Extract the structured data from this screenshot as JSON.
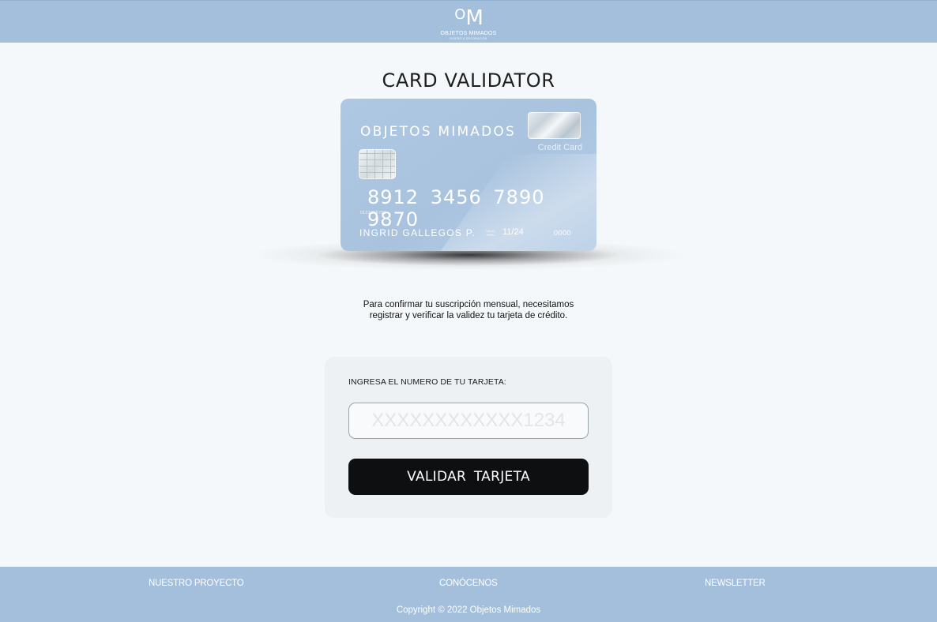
{
  "header": {
    "logo": {
      "mark_o": "O",
      "mark_m": "M",
      "name": "OBJETOS MIMADOS",
      "tagline": "DISEÑO & DECORACIÓN"
    }
  },
  "main": {
    "title": "CARD VALIDATOR",
    "card": {
      "brand": "OBJETOS MIMADOS",
      "type": "Credit Card",
      "number": "8912 3456 7890 9870",
      "small_number": "0123456789",
      "holder": "INGRID GALLEGOS P.",
      "valid_label": "VALID THRU",
      "expiry": "11/24",
      "cvv": "0000"
    },
    "intro_line1": "Para confirmar tu suscripción mensual, necesitamos",
    "intro_line2": "registrar y verificar la validez tu tarjeta de crédito.",
    "form": {
      "label": "INGRESA EL NUMERO DE TU TARJETA:",
      "input_value": "",
      "input_placeholder": "XXXXXXXXXXXX1234",
      "submit_label": "VALIDAR TARJETA"
    }
  },
  "footer": {
    "links": [
      "NUESTRO PROYECTO",
      "CONÓCENOS",
      "NEWSLETTER"
    ],
    "copyright": "Copyright © 2022 Objetos Mimados"
  },
  "colors": {
    "brand_blue": "#a3bfdb",
    "card_blue": "#aec8e4",
    "button_dark": "#0d0f10",
    "page_background": "#f5f8fa"
  }
}
